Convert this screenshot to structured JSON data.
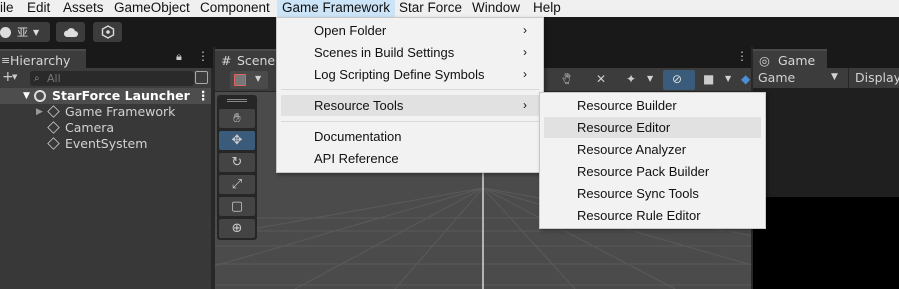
{
  "menubar": {
    "items": [
      "ile",
      "Edit",
      "Assets",
      "GameObject",
      "Component",
      "Game Framework",
      "Star Force",
      "Window",
      "Help"
    ]
  },
  "toolbar": {
    "account_label": "亚",
    "cloud_icon": "cloud-icon",
    "collab_icon": "collab-icon"
  },
  "hierarchy": {
    "tab_label": "Hierarchy",
    "search_placeholder": "All",
    "root": "StarForce Launcher",
    "children": [
      "Game Framework",
      "Camera",
      "EventSystem"
    ]
  },
  "scene": {
    "tab_label": "Scene"
  },
  "game": {
    "tab_label": "Game",
    "display_select": "Game",
    "display_label": "Display"
  },
  "game_framework_menu": {
    "items": [
      "Open Folder",
      "Scenes in Build Settings",
      "Log Scripting Define Symbols",
      "Resource Tools",
      "Documentation",
      "API Reference"
    ],
    "arrow": "›"
  },
  "resource_tools_menu": {
    "items": [
      "Resource Builder",
      "Resource Editor",
      "Resource Analyzer",
      "Resource Pack Builder",
      "Resource Sync Tools",
      "Resource Rule Editor"
    ]
  },
  "colors": {
    "menu_active": "#cce4f7",
    "selected_tool": "#3a5b7a",
    "menu_hover": "#e1e1e1"
  }
}
